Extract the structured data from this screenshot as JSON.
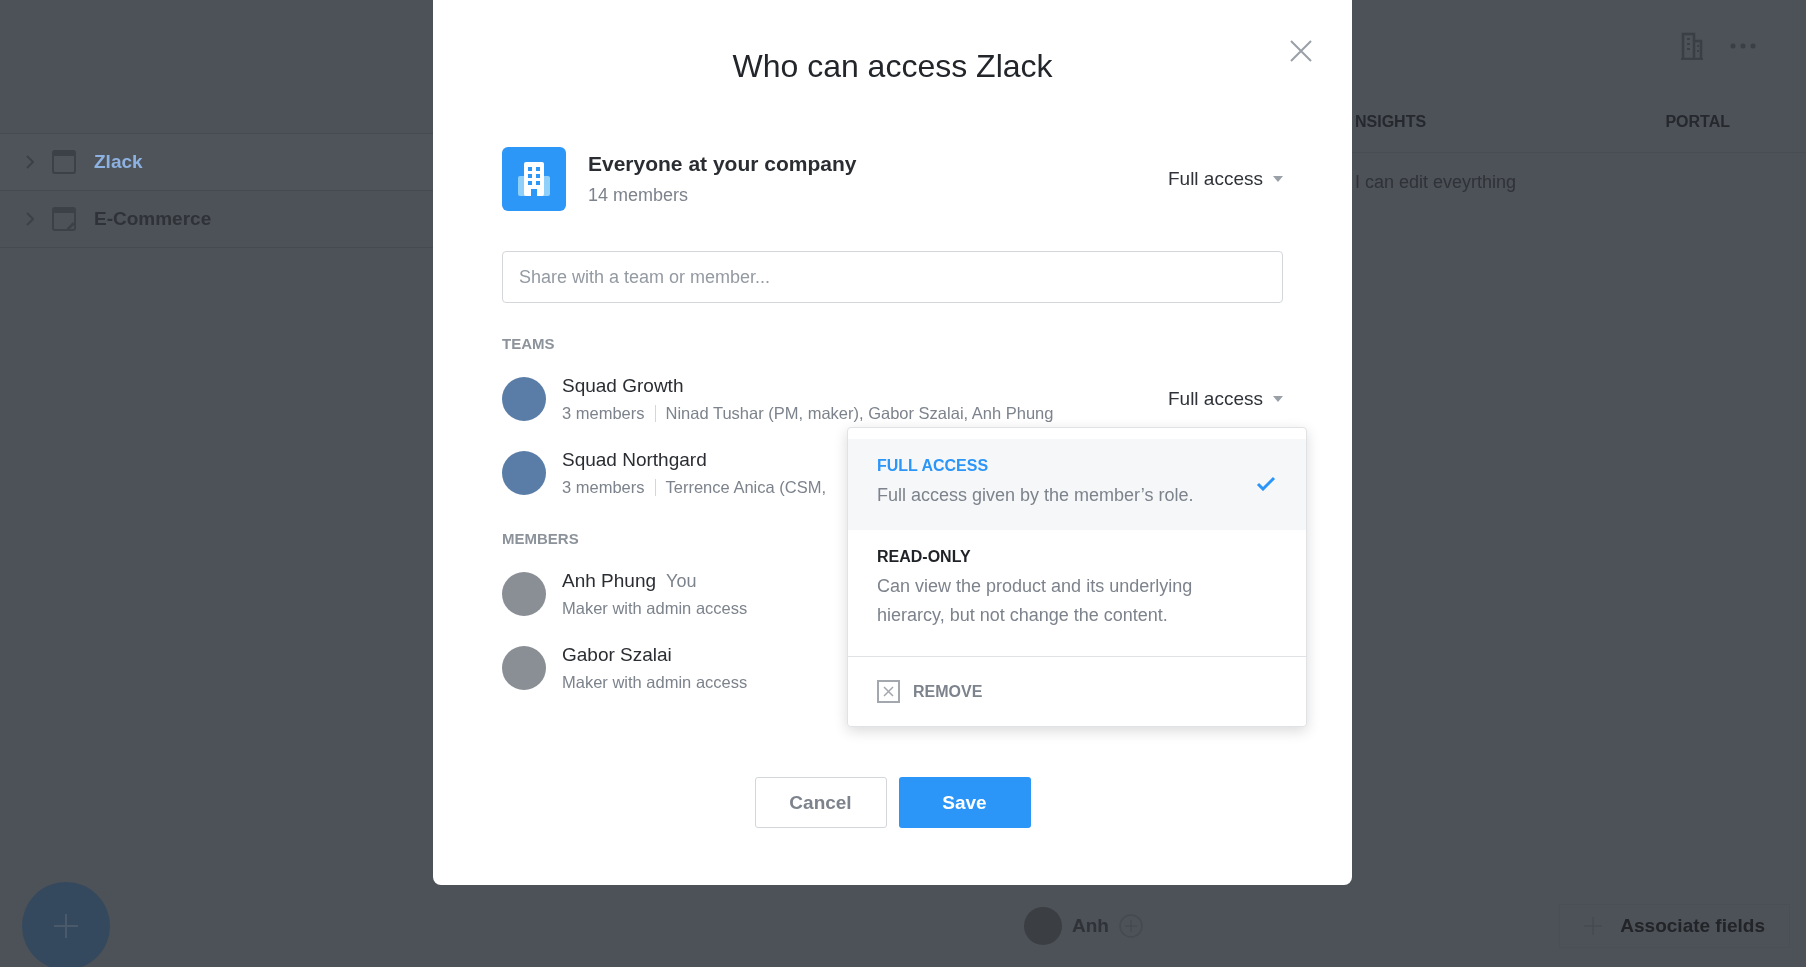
{
  "background": {
    "sidebar": {
      "items": [
        {
          "label": "Zlack",
          "selected": true
        },
        {
          "label": "E-Commerce",
          "selected": false
        }
      ]
    },
    "tabs": [
      {
        "label": "NSIGHTS"
      },
      {
        "label": "PORTAL"
      }
    ],
    "note": "I can edit eveyrthing",
    "footer": {
      "owner": "Anh",
      "action": "Associate fields"
    }
  },
  "dialog": {
    "title": "Who can access Zlack",
    "company": {
      "name": "Everyone at your company",
      "count": "14 members",
      "access": "Full access"
    },
    "search": {
      "placeholder": "Share with a team or member..."
    },
    "teams_label": "TEAMS",
    "teams": [
      {
        "name": "Squad Growth",
        "count": "3 members",
        "members": "Ninad Tushar (PM, maker), Gabor Szalai, Anh Phung",
        "access": "Full access"
      },
      {
        "name": "Squad Northgard",
        "count": "3 members",
        "members": "Terrence Anica (CSM,"
      }
    ],
    "members_label": "MEMBERS",
    "members": [
      {
        "name": "Anh Phung",
        "tag": "You",
        "role": "Maker with admin access"
      },
      {
        "name": "Gabor Szalai",
        "role": "Maker with admin access"
      }
    ],
    "dropdown": {
      "options": [
        {
          "title": "FULL ACCESS",
          "description": "Full access given by the member’s role.",
          "selected": true
        },
        {
          "title": "READ-ONLY",
          "description": "Can view the product and its underlying hierarcy, but not change the content.",
          "selected": false
        }
      ],
      "remove": "REMOVE"
    },
    "buttons": {
      "cancel": "Cancel",
      "save": "Save"
    }
  }
}
